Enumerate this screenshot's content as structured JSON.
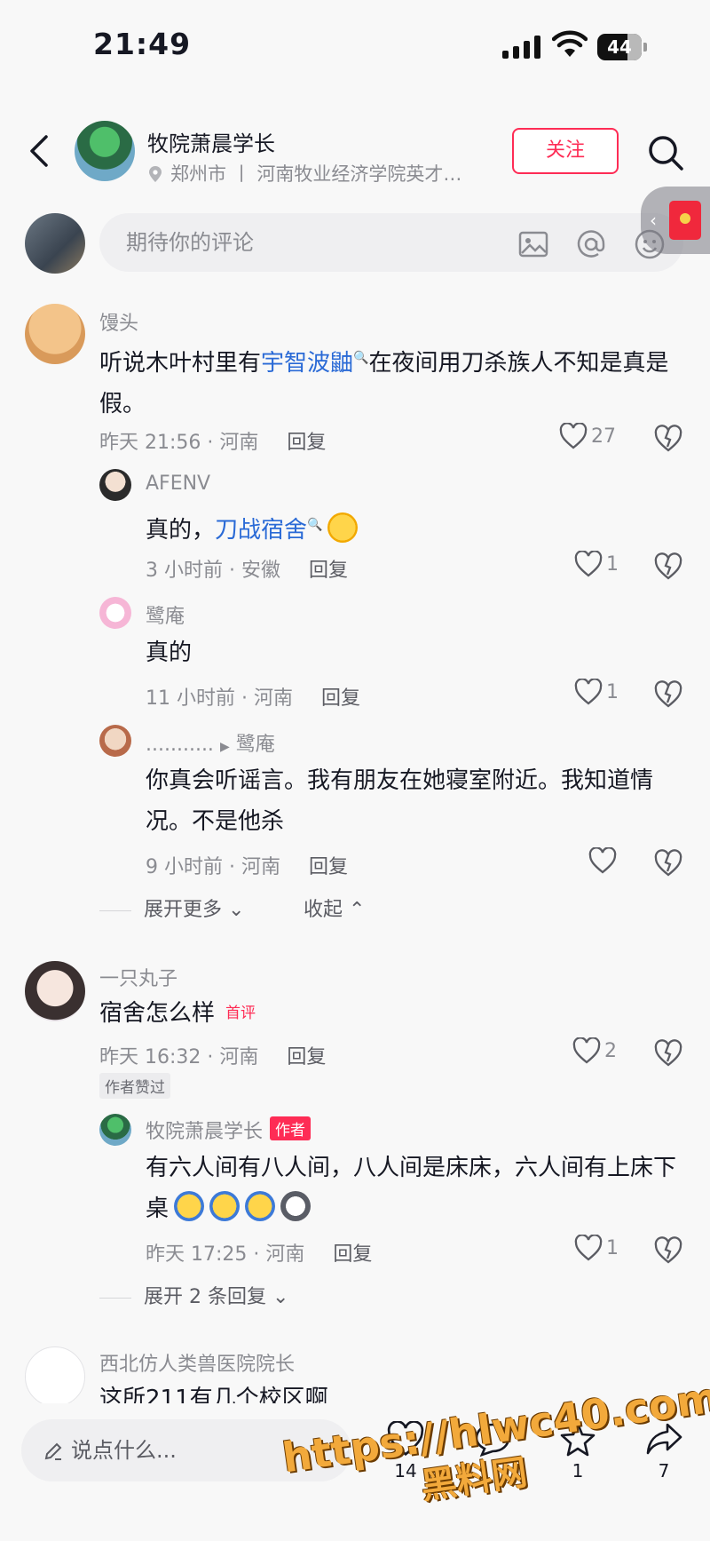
{
  "status_bar": {
    "time": "21:49",
    "battery": "44"
  },
  "header": {
    "author_name": "牧院萧晨学长",
    "location": "郑州市 丨 河南牧业经济学院英才…",
    "follow_label": "关注"
  },
  "compose": {
    "placeholder": "期待你的评论"
  },
  "comments": [
    {
      "user": "馒头",
      "text_before": "听说木叶村里有",
      "link": "宇智波鼬",
      "text_after": "在夜间用刀杀族人不知是真是假。",
      "meta": "昨天 21:56 · 河南",
      "reply_label": "回复",
      "likes": "27",
      "replies": [
        {
          "user": "AFENV",
          "text": "真的，",
          "link": "刀战宿舍",
          "meta": "3 小时前 · 安徽",
          "reply_label": "回复",
          "likes": "1"
        },
        {
          "user": "鹭庵",
          "text": "真的",
          "meta": "11 小时前 · 河南",
          "reply_label": "回复",
          "likes": "1"
        },
        {
          "user": "...........",
          "reply_to": "鹭庵",
          "text": "你真会听谣言。我有朋友在她寝室附近。我知道情况。不是他杀",
          "meta": "9 小时前 · 河南",
          "reply_label": "回复",
          "likes": ""
        }
      ],
      "expand_more": "展开更多",
      "collapse": "收起"
    },
    {
      "user": "一只丸子",
      "text": "宿舍怎么样",
      "first_tag": "首评",
      "meta": "昨天 16:32 · 河南",
      "reply_label": "回复",
      "likes": "2",
      "liked_by_author": "作者赞过",
      "replies": [
        {
          "user": "牧院萧晨学长",
          "author_tag": "作者",
          "text": "有六人间有八人间，八人间是床床，六人间有上床下桌",
          "meta": "昨天 17:25 · 河南",
          "reply_label": "回复",
          "likes": "1"
        }
      ],
      "expand_more": "展开 2 条回复"
    },
    {
      "user": "西北仿人类兽医院院长",
      "text": "这所211有几个校区啊"
    }
  ],
  "bottom_bar": {
    "say_placeholder": "说点什么...",
    "like_count": "14",
    "comment_count": "",
    "star_count": "1",
    "share_count": "7"
  },
  "watermark": {
    "line1": "https://hlwc40.com",
    "line2": "黑料网"
  },
  "colors": {
    "accent": "#fe2c55",
    "link": "#2a6ad6",
    "muted": "#8a8b91"
  }
}
